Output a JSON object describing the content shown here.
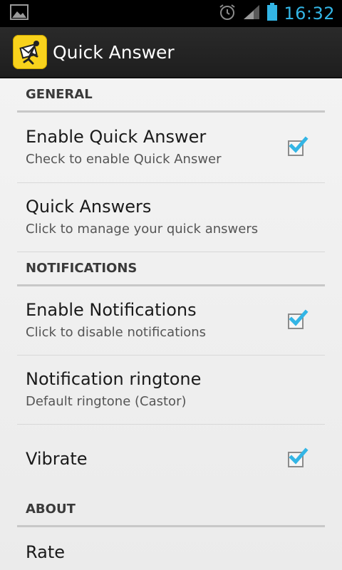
{
  "status_bar": {
    "time": "16:32",
    "icons": [
      "image-notification-icon",
      "alarm-icon",
      "signal-icon",
      "battery-icon"
    ]
  },
  "action_bar": {
    "title": "Quick Answer",
    "icon": "quick-answer-app-icon"
  },
  "colors": {
    "accent": "#33b5e5",
    "checkbox_check": "#33b5e5",
    "app_icon_bg": "#f8d21c"
  },
  "sections": [
    {
      "header": "GENERAL",
      "items": [
        {
          "title": "Enable Quick Answer",
          "summary": "Check to enable Quick Answer",
          "checked": true
        },
        {
          "title": "Quick Answers",
          "summary": "Click to manage your quick answers"
        }
      ]
    },
    {
      "header": "NOTIFICATIONS",
      "items": [
        {
          "title": "Enable Notifications",
          "summary": "Click to disable notifications",
          "checked": true
        },
        {
          "title": "Notification ringtone",
          "summary": "Default ringtone (Castor)"
        },
        {
          "title": "Vibrate",
          "checked": true
        }
      ]
    },
    {
      "header": "ABOUT",
      "items": [
        {
          "title": "Rate"
        }
      ]
    }
  ]
}
